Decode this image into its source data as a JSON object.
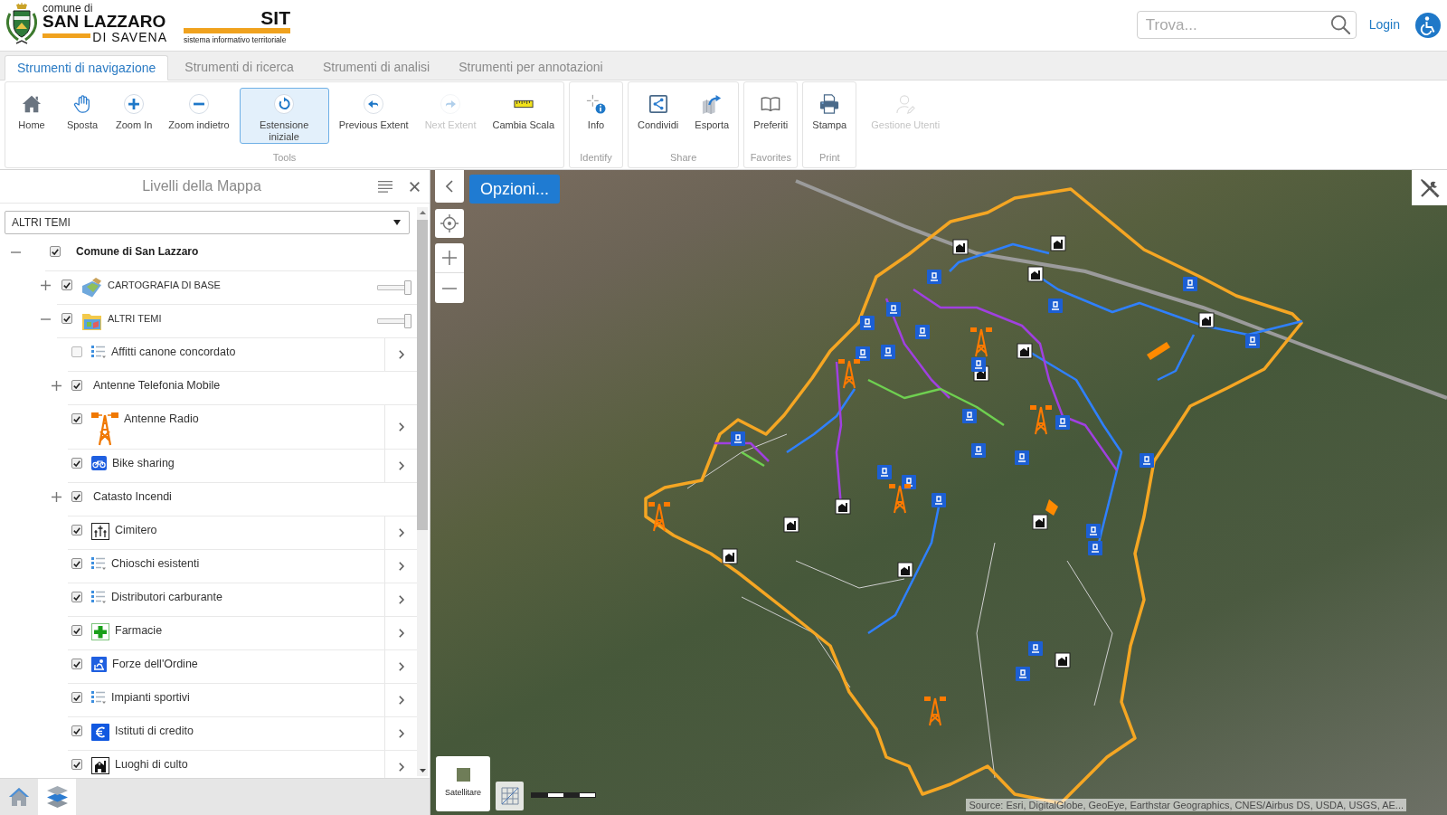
{
  "header": {
    "logo": {
      "prefix": "comune di",
      "name": "SAN LAZZARO",
      "suffix": "DI SAVENA"
    },
    "app_logo": {
      "title": "SIT",
      "subtitle": "sistema informativo territoriale"
    },
    "search": {
      "placeholder": "Trova..."
    },
    "login": "Login"
  },
  "tabs": [
    {
      "label": "Strumenti di navigazione",
      "selected": true
    },
    {
      "label": "Strumenti di ricerca",
      "selected": false
    },
    {
      "label": "Strumenti di analisi",
      "selected": false
    },
    {
      "label": "Strumenti per annotazioni",
      "selected": false
    }
  ],
  "toolbar": {
    "groups": [
      {
        "label": "Tools",
        "buttons": [
          {
            "label": "Home",
            "selected": false,
            "disabled": false
          },
          {
            "label": "Sposta",
            "selected": false,
            "disabled": false
          },
          {
            "label": "Zoom In",
            "selected": false,
            "disabled": false
          },
          {
            "label": "Zoom indietro",
            "selected": false,
            "disabled": false
          },
          {
            "label": "Estensione iniziale",
            "selected": true,
            "disabled": false
          },
          {
            "label": "Previous Extent",
            "selected": false,
            "disabled": false
          },
          {
            "label": "Next Extent",
            "selected": false,
            "disabled": true
          },
          {
            "label": "Cambia Scala",
            "selected": false,
            "disabled": false
          }
        ]
      },
      {
        "label": "Identify",
        "buttons": [
          {
            "label": "Info",
            "selected": false,
            "disabled": false
          }
        ]
      },
      {
        "label": "Share",
        "buttons": [
          {
            "label": "Condividi",
            "selected": false,
            "disabled": false
          },
          {
            "label": "Esporta",
            "selected": false,
            "disabled": false
          }
        ]
      },
      {
        "label": "Favorites",
        "buttons": [
          {
            "label": "Preferiti",
            "selected": false,
            "disabled": false
          }
        ]
      },
      {
        "label": "Print",
        "buttons": [
          {
            "label": "Stampa",
            "selected": false,
            "disabled": false
          }
        ]
      },
      {
        "buttons": [
          {
            "label": "Gestione Utenti",
            "selected": false,
            "disabled": true
          }
        ]
      }
    ]
  },
  "layers_panel": {
    "title": "Livelli della Mappa",
    "theme_select": "ALTRI TEMI",
    "tree": [
      {
        "kind": "root",
        "label": "Comune di San Lazzaro",
        "checked": true,
        "expanded": true,
        "children": [
          {
            "kind": "theme",
            "label": "CARTOGRAFIA DI BASE",
            "checked": true,
            "expanded": false,
            "level": 1
          },
          {
            "kind": "theme",
            "label": "ALTRI TEMI",
            "checked": true,
            "expanded": true,
            "level": 1,
            "children": [
              {
                "kind": "layer",
                "label": "Affitti canone concordato",
                "checked": false
              },
              {
                "kind": "group",
                "label": "Antenne Telefonia Mobile",
                "checked": true,
                "expanded": false
              },
              {
                "kind": "layer",
                "label": "Antenne Radio",
                "checked": true
              },
              {
                "kind": "layer",
                "label": "Bike sharing",
                "checked": true
              },
              {
                "kind": "group",
                "label": "Catasto Incendi",
                "checked": true,
                "expanded": false
              },
              {
                "kind": "layer",
                "label": "Cimitero",
                "checked": true
              },
              {
                "kind": "layer",
                "label": "Chioschi esistenti",
                "checked": true
              },
              {
                "kind": "layer",
                "label": "Distributori carburante",
                "checked": true
              },
              {
                "kind": "layer",
                "label": "Farmacie",
                "checked": true
              },
              {
                "kind": "layer",
                "label": "Forze dell'Ordine",
                "checked": true
              },
              {
                "kind": "layer",
                "label": "Impianti sportivi",
                "checked": true
              },
              {
                "kind": "layer",
                "label": "Istituti di credito",
                "checked": true
              },
              {
                "kind": "layer",
                "label": "Luoghi di culto",
                "checked": true
              }
            ]
          }
        ]
      }
    ],
    "bottom_tabs": [
      {
        "selected": false
      },
      {
        "selected": true
      }
    ]
  },
  "map": {
    "options_button": "Opzioni...",
    "basemap_label": "Satellitare",
    "attribution": "Source: Esri, DigitalGlobe, GeoEye, Earthstar Geographics, CNES/Airbus DS, USDA, USGS, AE..."
  }
}
